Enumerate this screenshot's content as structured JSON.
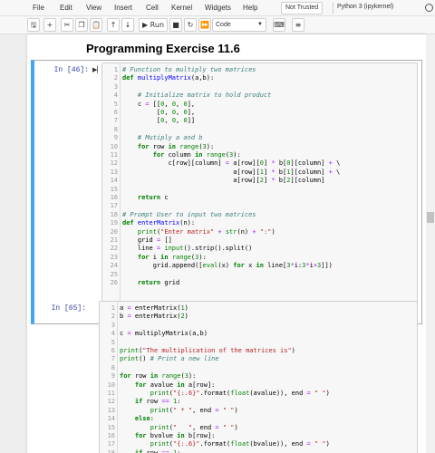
{
  "menubar": {
    "items": [
      "File",
      "Edit",
      "View",
      "Insert",
      "Cell",
      "Kernel",
      "Widgets",
      "Help"
    ],
    "trust_status": "Not Trusted",
    "kernel_name": "Python 3 (ipykernel)"
  },
  "toolbar": {
    "save_icon": "save-icon",
    "add_icon": "plus-icon",
    "cut_icon": "scissors-icon",
    "copy_icon": "copy-icon",
    "paste_icon": "paste-icon",
    "up_icon": "arrow-up-icon",
    "down_icon": "arrow-down-icon",
    "run_label": "Run",
    "stop_icon": "stop-icon",
    "restart_icon": "restart-icon",
    "restart_run_icon": "fast-forward-icon",
    "cell_type": "Code",
    "keyboard_icon": "keyboard-icon",
    "palette_icon": "command-palette-icon"
  },
  "notebook": {
    "heading": "Programming Exercise 11.6",
    "cells": [
      {
        "prompt": "In [46]:",
        "lines": [
          {
            "n": "1",
            "code": "# Function to multiply two matrices"
          },
          {
            "n": "2",
            "code": "def multiplyMatrix(a,b):"
          },
          {
            "n": "3",
            "code": ""
          },
          {
            "n": "4",
            "code": "    # Initialize matrix to hold product"
          },
          {
            "n": "5",
            "code": "    c = [[0, 0, 0],"
          },
          {
            "n": "6",
            "code": "         [0, 0, 0],"
          },
          {
            "n": "7",
            "code": "         [0, 0, 0]]"
          },
          {
            "n": "8",
            "code": ""
          },
          {
            "n": "9",
            "code": "    # Mutiply a and b"
          },
          {
            "n": "10",
            "code": "    for row in range(3):"
          },
          {
            "n": "11",
            "code": "        for column in range(3):"
          },
          {
            "n": "12",
            "code": "            c[row][column] = a[row][0] * b[0][column] + \\"
          },
          {
            "n": "13",
            "code": "                             a[row][1] * b[1][column] + \\"
          },
          {
            "n": "14",
            "code": "                             a[row][2] * b[2][column]"
          },
          {
            "n": "15",
            "code": ""
          },
          {
            "n": "16",
            "code": "    return c"
          },
          {
            "n": "17",
            "code": ""
          },
          {
            "n": "18",
            "code": "# Prompt User to input two matrices"
          },
          {
            "n": "19",
            "code": "def enterMatrix(n):"
          },
          {
            "n": "20",
            "code": "    print(\"Enter matrix\" + str(n) + \":\")"
          },
          {
            "n": "21",
            "code": "    grid = []"
          },
          {
            "n": "22",
            "code": "    line = input().strip().split()"
          },
          {
            "n": "23",
            "code": "    for i in range(3):"
          },
          {
            "n": "24",
            "code": "        grid.append([eval(x) for x in line[3*i:3*i+3]])"
          },
          {
            "n": "25",
            "code": ""
          },
          {
            "n": "26",
            "code": "    return grid"
          }
        ]
      },
      {
        "prompt": "In [65]:",
        "lines": [
          {
            "n": "1",
            "code": "a = enterMatrix(1)"
          },
          {
            "n": "2",
            "code": "b = enterMatrix(2)"
          },
          {
            "n": "3",
            "code": ""
          },
          {
            "n": "4",
            "code": "c = multiplyMatrix(a,b)"
          },
          {
            "n": "5",
            "code": ""
          },
          {
            "n": "6",
            "code": "print(\"The multiplication of the matrices is\")"
          },
          {
            "n": "7",
            "code": "print() # Print a new line"
          },
          {
            "n": "8",
            "code": ""
          },
          {
            "n": "9",
            "code": "for row in range(3):"
          },
          {
            "n": "10",
            "code": "    for avalue in a[row]:"
          },
          {
            "n": "11",
            "code": "        print(\"{:.6}\".format(float(avalue)), end = \" \")"
          },
          {
            "n": "12",
            "code": "    if row == 1:"
          },
          {
            "n": "13",
            "code": "        print(\" * \", end = \" \")"
          },
          {
            "n": "14",
            "code": "    else:"
          },
          {
            "n": "15",
            "code": "        print(\"   \", end = \" \")"
          },
          {
            "n": "16",
            "code": "    for bvalue in b[row]:"
          },
          {
            "n": "17",
            "code": "        print(\"{:.6}\".format(float(bvalue)), end = \" \")"
          },
          {
            "n": "18",
            "code": "    if row == 1:"
          }
        ]
      }
    ]
  },
  "colors": {
    "accent": "#42a5f5",
    "prompt": "#303f9f",
    "comment": "#408080",
    "keyword": "#008000",
    "function_name": "#0000ff",
    "string": "#ba2121"
  }
}
